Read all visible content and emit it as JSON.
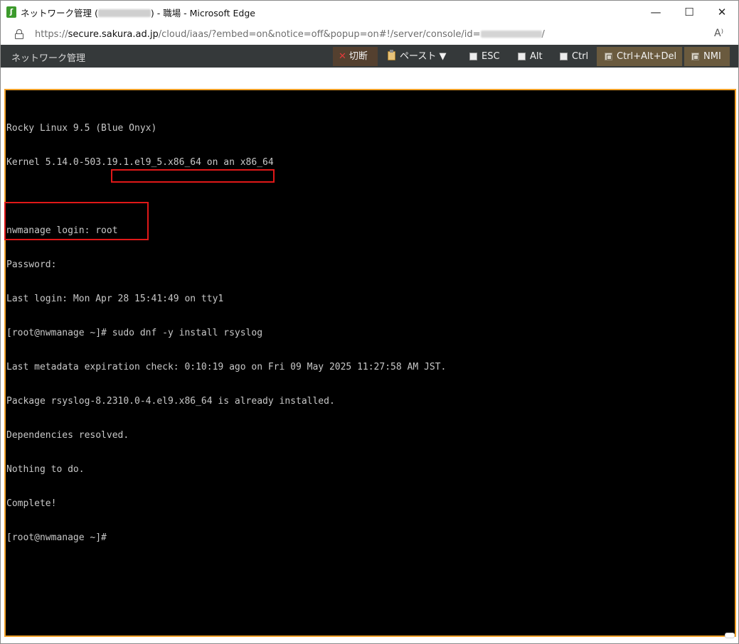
{
  "window": {
    "title_prefix": "ネットワーク管理 (",
    "title_suffix": ") - 職場 - Microsoft Edge",
    "app_icon_glyph": "ʃ",
    "controls": {
      "minimize": "—",
      "maximize": "☐",
      "close": "✕"
    }
  },
  "address_bar": {
    "url_scheme": "https://",
    "url_host": "secure.sakura.ad.jp",
    "url_path": "/cloud/iaas/?embed=on&notice=off&popup=on#!/server/console/id=",
    "url_end": "/",
    "read_aloud_glyph": "A⁾"
  },
  "toolbar": {
    "title": "ネットワーク管理",
    "buttons": {
      "cut": {
        "icon": "✕",
        "label": "切断"
      },
      "paste": {
        "label": "ペースト ▼"
      },
      "esc": {
        "label": "ESC"
      },
      "alt": {
        "label": "Alt"
      },
      "ctrl": {
        "label": "Ctrl"
      },
      "ctrl_alt_del": {
        "label": "Ctrl+Alt+Del"
      },
      "nmi": {
        "label": "NMI"
      }
    }
  },
  "console": {
    "lines": [
      "Rocky Linux 9.5 (Blue Onyx)",
      "Kernel 5.14.0-503.19.1.el9_5.x86_64 on an x86_64",
      "",
      "nwmanage login: root",
      "Password:",
      "Last login: Mon Apr 28 15:41:49 on tty1",
      "[root@nwmanage ~]# sudo dnf -y install rsyslog",
      "Last metadata expiration check: 0:10:19 ago on Fri 09 May 2025 11:27:58 AM JST.",
      "Package rsyslog-8.2310.0-4.el9.x86_64 is already installed.",
      "Dependencies resolved.",
      "Nothing to do.",
      "Complete!",
      "[root@nwmanage ~]#"
    ]
  },
  "colors": {
    "toolbar_bg": "#35393a",
    "console_border": "#f0a028",
    "highlight": "#e01818",
    "terminal_text": "#c8c8c8"
  }
}
